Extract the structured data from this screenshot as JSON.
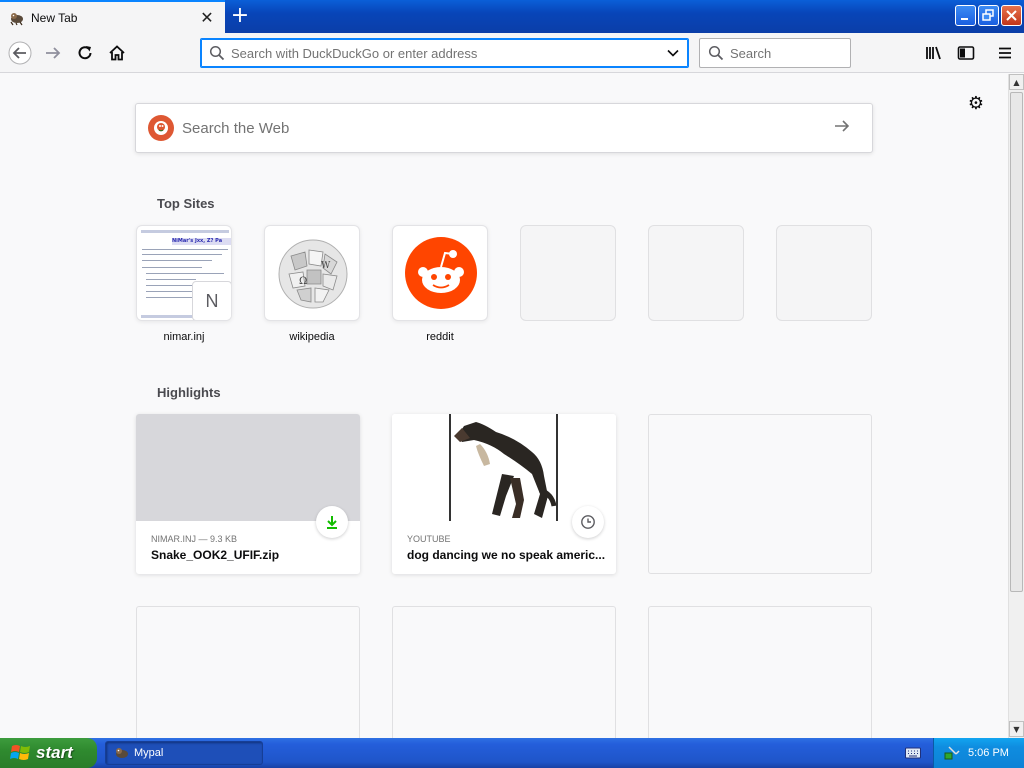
{
  "browser": {
    "tab": {
      "title": "New Tab",
      "favicon": "mypal-icon"
    },
    "new_tab_label": "+",
    "url_placeholder": "Search with DuckDuckGo or enter address",
    "search_placeholder": "Search"
  },
  "newtab": {
    "websearch_placeholder": "Search the Web",
    "top_sites_heading": "Top Sites",
    "top_sites": [
      {
        "label": "nimar.inj",
        "badge": "N",
        "thumb_header": "NiMar's Jxx, Z? Pa"
      },
      {
        "label": "wikipedia"
      },
      {
        "label": "reddit"
      },
      {
        "label": ""
      },
      {
        "label": ""
      },
      {
        "label": ""
      }
    ],
    "highlights_heading": "Highlights",
    "highlights": [
      {
        "meta": "NIMAR.INJ — 9.3 KB",
        "title": "Snake_OOK2_UFIF.zip",
        "badge_icon": "download-icon"
      },
      {
        "meta": "YOUTUBE",
        "title": "dog dancing we no speak americ...",
        "badge_icon": "clock-icon"
      }
    ]
  },
  "taskbar": {
    "start_label": "start",
    "task_label": "Mypal",
    "clock": "5:06 PM"
  },
  "colors": {
    "accent": "#0a84ff",
    "download_green": "#12bc00",
    "reddit_orange": "#ff4500",
    "ddg_orange": "#de5833"
  }
}
